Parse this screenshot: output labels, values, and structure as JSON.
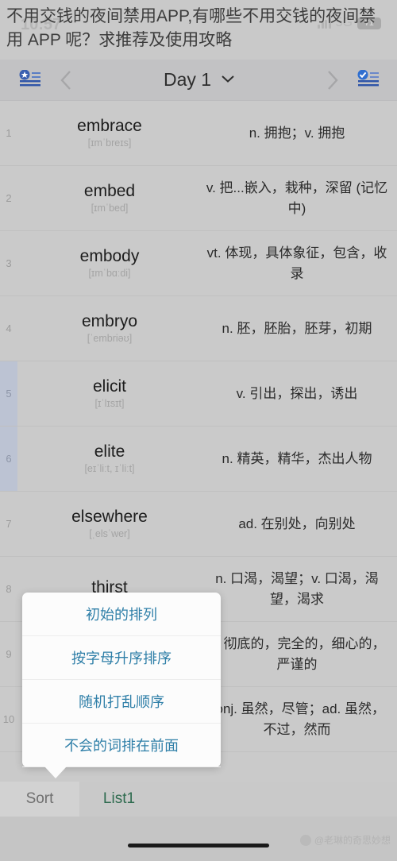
{
  "status_bar": {
    "time": "10:57",
    "network": "5G",
    "battery": "71",
    "signal_icon": "signal-bars-icon"
  },
  "article_title": "不用交钱的夜间禁用APP,有哪些不用交钱的夜间禁用 APP 呢？求推荐及使用攻略",
  "navbar": {
    "left_icon": "starred-list-icon",
    "right_icon": "checked-list-icon",
    "prev_icon": "chevron-left-icon",
    "next_icon": "chevron-right-icon",
    "title": "Day 1",
    "caret_icon": "chevron-down-icon"
  },
  "word_list": [
    {
      "num": "1",
      "word": "embrace",
      "ipa": "[ɪmˈbreɪs]",
      "def": "n. 拥抱；v. 拥抱",
      "selected": false
    },
    {
      "num": "2",
      "word": "embed",
      "ipa": "[ɪmˈbed]",
      "def": "v. 把...嵌入，栽种，深留 (记忆中)",
      "selected": false
    },
    {
      "num": "3",
      "word": "embody",
      "ipa": "[ɪmˈbɑːdi]",
      "def": "vt. 体现，具体象征，包含，收录",
      "selected": false
    },
    {
      "num": "4",
      "word": "embryo",
      "ipa": "[ˈembriəʊ]",
      "def": "n. 胚，胚胎，胚芽，初期",
      "selected": false
    },
    {
      "num": "5",
      "word": "elicit",
      "ipa": "[ɪˈlɪsɪt]",
      "def": "v. 引出，探出，诱出",
      "selected": true
    },
    {
      "num": "6",
      "word": "elite",
      "ipa": "[eɪˈliːt, ɪˈliːt]",
      "def": "n. 精英，精华，杰出人物",
      "selected": true
    },
    {
      "num": "7",
      "word": "elsewhere",
      "ipa": "[ˌelsˈwer]",
      "def": "ad. 在别处，向别处",
      "selected": false
    },
    {
      "num": "8",
      "word": "thirst",
      "ipa": "",
      "def": "n. 口渴，渴望；v. 口渴，渴望，渴求",
      "selected": false
    },
    {
      "num": "9",
      "word": "",
      "ipa": "",
      "def": "a. 彻底的，完全的，细心的，严谨的",
      "selected": false
    },
    {
      "num": "10",
      "word": "",
      "ipa": "",
      "def": "conj. 虽然，尽管；ad. 虽然，不过，然而",
      "selected": false
    }
  ],
  "sort_popup": {
    "items": [
      {
        "label": "初始的排列"
      },
      {
        "label": "按字母升序排序"
      },
      {
        "label": "随机打乱顺序"
      },
      {
        "label": "不会的词排在前面"
      }
    ]
  },
  "tabs": [
    {
      "label": "Sort",
      "active": false
    },
    {
      "label": "List1",
      "active": true
    }
  ],
  "watermark": "@老琳的奇思妙想",
  "colors": {
    "accent_blue": "#2f7fa8",
    "list_bg": "#cacaca",
    "nav_bg": "#c2c2c4",
    "selected_band": "#bcc3d3",
    "tab_active": "#2e6b4f"
  }
}
